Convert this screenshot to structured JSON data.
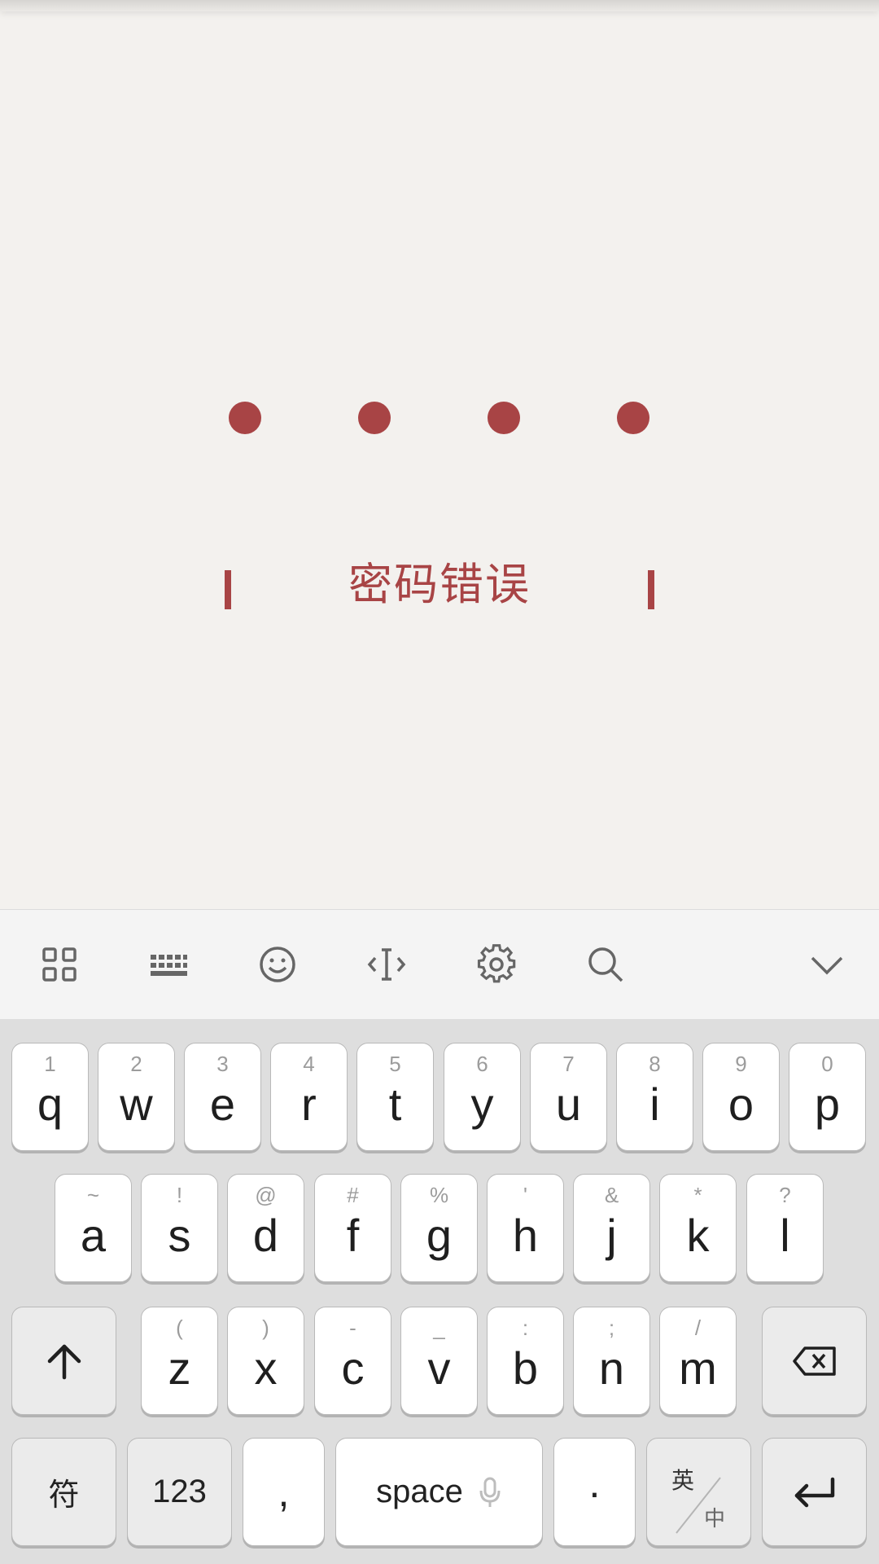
{
  "pin": {
    "dots_filled": 4,
    "error_message": "密码错误"
  },
  "toolbar": {
    "icons": [
      "apps-grid-icon",
      "keyboard-icon",
      "emoji-icon",
      "cursor-icon",
      "gear-icon",
      "search-icon",
      "chevron-down-icon"
    ]
  },
  "keyboard": {
    "row1": [
      {
        "main": "q",
        "sub": "1"
      },
      {
        "main": "w",
        "sub": "2"
      },
      {
        "main": "e",
        "sub": "3"
      },
      {
        "main": "r",
        "sub": "4"
      },
      {
        "main": "t",
        "sub": "5"
      },
      {
        "main": "y",
        "sub": "6"
      },
      {
        "main": "u",
        "sub": "7"
      },
      {
        "main": "i",
        "sub": "8"
      },
      {
        "main": "o",
        "sub": "9"
      },
      {
        "main": "p",
        "sub": "0"
      }
    ],
    "row2": [
      {
        "main": "a",
        "sub": "~"
      },
      {
        "main": "s",
        "sub": "!"
      },
      {
        "main": "d",
        "sub": "@"
      },
      {
        "main": "f",
        "sub": "#"
      },
      {
        "main": "g",
        "sub": "%"
      },
      {
        "main": "h",
        "sub": "'"
      },
      {
        "main": "j",
        "sub": "&"
      },
      {
        "main": "k",
        "sub": "*"
      },
      {
        "main": "l",
        "sub": "?"
      }
    ],
    "row3": [
      {
        "main": "z",
        "sub": "("
      },
      {
        "main": "x",
        "sub": ")"
      },
      {
        "main": "c",
        "sub": "-"
      },
      {
        "main": "v",
        "sub": "_"
      },
      {
        "main": "b",
        "sub": ":"
      },
      {
        "main": "n",
        "sub": ";"
      },
      {
        "main": "m",
        "sub": "/"
      }
    ],
    "symbols_label": "符",
    "numbers_label": "123",
    "comma_label": ",",
    "space_label": "space",
    "period_label": "·",
    "lang_en": "英",
    "lang_cn": "中"
  },
  "colors": {
    "accent": "#a84445",
    "background": "#f3f1ee",
    "keyboard_bg": "#dedede"
  }
}
